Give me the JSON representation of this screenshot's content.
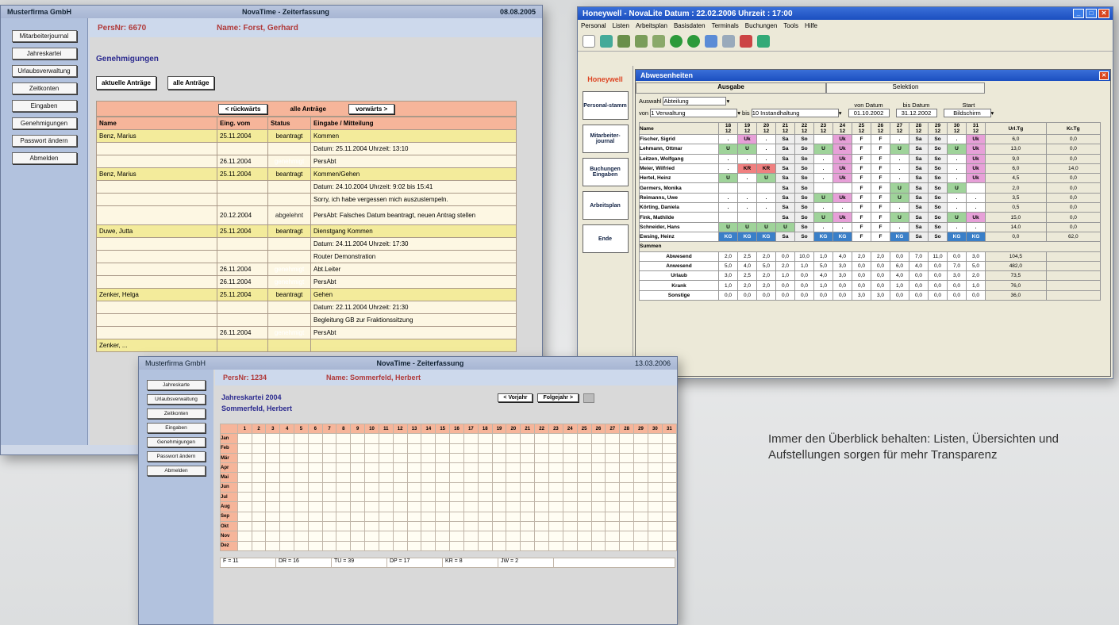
{
  "caption": "Immer den Überblick behalten: Listen, Übersichten und Aufstellungen sorgen für mehr Transparenz",
  "w1": {
    "company": "Musterfirma GmbH",
    "title": "NovaTime - Zeiterfassung",
    "date": "08.08.2005",
    "nav": [
      "Mitarbeiterjournal",
      "Jahreskartei",
      "Urlaubsverwaltung",
      "Zeitkonten",
      "Eingaben",
      "Genehmigungen",
      "Passwort ändern",
      "Abmelden"
    ],
    "persnr": "PersNr: 6670",
    "name": "Name: Forst, Gerhard",
    "section": "Genehmigungen",
    "btn_current": "aktuelle Anträge",
    "btn_all": "alle Anträge",
    "btn_back": "< rückwärts",
    "filter_label": "alle Anträge",
    "btn_fwd": "vorwärts >",
    "columns": [
      "Name",
      "Eing. vom",
      "Status",
      "Eingabe / Mitteilung"
    ],
    "rows": [
      [
        "Benz, Marius",
        "25.11.2004",
        "beantragt",
        "Kommen",
        "y"
      ],
      [
        "",
        "",
        "",
        "Datum: 25.11.2004 Uhrzeit: 13:10",
        ""
      ],
      [
        "",
        "26.11.2004",
        "genehmigt",
        "PersAbt",
        ""
      ],
      [
        "Benz, Marius",
        "25.11.2004",
        "beantragt",
        "Kommen/Gehen",
        "y"
      ],
      [
        "",
        "",
        "",
        "Datum: 24.10.2004 Uhrzeit: 9:02 bis 15:41",
        ""
      ],
      [
        "",
        "",
        "",
        "Sorry, ich habe vergessen mich auszustempeln.",
        ""
      ],
      [
        "",
        "20.12.2004",
        "abgelehnt",
        "PersAbt: Falsches Datum beantragt, neuen Antrag stellen",
        ""
      ],
      [
        "Duwe, Jutta",
        "25.11.2004",
        "beantragt",
        "Dienstgang Kommen",
        "y"
      ],
      [
        "",
        "",
        "",
        "Datum: 24.11.2004 Uhrzeit: 17:30",
        ""
      ],
      [
        "",
        "",
        "",
        "Router Demonstration",
        ""
      ],
      [
        "",
        "26.11.2004",
        "genehmigt",
        "Abt.Leiter",
        ""
      ],
      [
        "",
        "26.11.2004",
        "genehmigt",
        "PersAbt",
        ""
      ],
      [
        "Zenker, Helga",
        "25.11.2004",
        "beantragt",
        "Gehen",
        "y"
      ],
      [
        "",
        "",
        "",
        "Datum: 22.11.2004 Uhrzeit: 21:30",
        ""
      ],
      [
        "",
        "",
        "",
        "Begleitung GB zur Fraktionssitzung",
        ""
      ],
      [
        "",
        "26.11.2004",
        "genehmigt",
        "PersAbt",
        ""
      ],
      [
        "Zenker, ...",
        "",
        "",
        "",
        "y"
      ]
    ]
  },
  "w2": {
    "title": "Honeywell - NovaLite     Datum : 22.02.2006     Uhrzeit : 17:00",
    "menu": [
      "Personal",
      "Listen",
      "Arbeitsplan",
      "Basisdaten",
      "Terminals",
      "Buchungen",
      "Tools",
      "Hilfe"
    ],
    "logo": "Honeywell",
    "side": [
      "Personal-stamm",
      "Mitarbeiter-journal",
      "Buchungen Eingaben",
      "Arbeitsplan",
      "Ende"
    ],
    "panel": "Abwesenheiten",
    "tab1": "Ausgabe",
    "tab2": "Selektion",
    "auswahl_label": "Auswahl",
    "auswahl": "Abteilung",
    "von_label": "von",
    "von": "1 Verwaltung",
    "bis_label": "bis",
    "bis": "10 Instandhaltung",
    "vondatum_label": "von Datum",
    "vondatum": "01.10.2002",
    "bisdatum_label": "bis Datum",
    "bisdatum": "31.12.2002",
    "start_label": "Start",
    "start": "Bildschirm",
    "days": [
      "18",
      "19",
      "20",
      "21",
      "22",
      "23",
      "24",
      "25",
      "26",
      "27",
      "28",
      "29",
      "30",
      "31"
    ],
    "month": "12",
    "col_name": "Name",
    "col_url": "Url.Tg",
    "col_kr": "Kr.Tg",
    "rows": [
      [
        "Fischer, Sigrid",
        [
          ".",
          "Uk",
          ".",
          "Sa",
          "So",
          "",
          "Uk",
          "F",
          "F",
          ".",
          "Sa",
          "So",
          ".",
          "Uk"
        ],
        "6,0",
        "0,0"
      ],
      [
        "Lehmann, Ottmar",
        [
          "U",
          "U",
          ".",
          "Sa",
          "So",
          "U",
          "Uk",
          "F",
          "F",
          "U",
          "Sa",
          "So",
          "U",
          "Uk"
        ],
        "13,0",
        "0,0"
      ],
      [
        "Leitzen, Wolfgang",
        [
          ".",
          ".",
          ".",
          "Sa",
          "So",
          ".",
          "Uk",
          "F",
          "F",
          ".",
          "Sa",
          "So",
          ".",
          "Uk"
        ],
        "9,0",
        "0,0"
      ],
      [
        "Meier, Wilfried",
        [
          ".",
          "KR",
          "KR",
          "Sa",
          "So",
          ".",
          "Uk",
          "F",
          "F",
          ".",
          "Sa",
          "So",
          ".",
          "Uk"
        ],
        "6,0",
        "14,0"
      ],
      [
        "Hertel, Heinz",
        [
          "U",
          ".",
          "U",
          "Sa",
          "So",
          ".",
          "Uk",
          "F",
          "F",
          ".",
          "Sa",
          "So",
          ".",
          "Uk"
        ],
        "4,5",
        "0,0"
      ],
      [
        "Germers, Monika",
        [
          "",
          "",
          "",
          "Sa",
          "So",
          "",
          "",
          "F",
          "F",
          "U",
          "Sa",
          "So",
          "U",
          ""
        ],
        "2,0",
        "0,0"
      ],
      [
        "Reimanns, Uwe",
        [
          ".",
          ".",
          ".",
          "Sa",
          "So",
          "U",
          "Uk",
          "F",
          "F",
          "U",
          "Sa",
          "So",
          ".",
          "."
        ],
        "3,5",
        "0,0"
      ],
      [
        "Körting, Daniela",
        [
          ".",
          ".",
          ".",
          "Sa",
          "So",
          ".",
          ".",
          "F",
          "F",
          ".",
          "Sa",
          "So",
          ".",
          "."
        ],
        "0,5",
        "0,0"
      ],
      [
        "Fink, Mathilde",
        [
          "",
          "",
          "",
          "Sa",
          "So",
          "U",
          "Uk",
          "F",
          "F",
          "U",
          "Sa",
          "So",
          "U",
          "Uk"
        ],
        "15,0",
        "0,0"
      ],
      [
        "Schneider, Hans",
        [
          "U",
          "U",
          "U",
          "U",
          "So",
          ".",
          ".",
          "F",
          "F",
          ".",
          "Sa",
          "So",
          ".",
          "."
        ],
        "14,0",
        "0,0"
      ],
      [
        "Ewsing, Heinz",
        [
          "KG",
          "KG",
          "KG",
          "Sa",
          "So",
          "KG",
          "KG",
          "F",
          "F",
          "KG",
          "Sa",
          "So",
          "KG",
          "KG"
        ],
        "0,0",
        "62,0"
      ]
    ],
    "sums_label": "Summen",
    "sums": [
      [
        "Abwesend",
        [
          "2,0",
          "2,5",
          "2,0",
          "0,0",
          "10,0",
          "1,0",
          "4,0",
          "2,0",
          "2,0",
          "0,0",
          "7,0",
          "11,0",
          "0,0",
          "3,0"
        ],
        "104,5"
      ],
      [
        "Anwesend",
        [
          "5,0",
          "4,0",
          "5,0",
          "2,0",
          "1,0",
          "5,0",
          "3,0",
          "0,0",
          "0,0",
          "6,0",
          "4,0",
          "0,0",
          "7,0",
          "5,0"
        ],
        "482,0"
      ],
      [
        "Urlaub",
        [
          "3,0",
          "2,5",
          "2,0",
          "1,0",
          "0,0",
          "4,0",
          "3,0",
          "0,0",
          "0,0",
          "4,0",
          "0,0",
          "0,0",
          "3,0",
          "2,0"
        ],
        "73,5"
      ],
      [
        "Krank",
        [
          "1,0",
          "2,0",
          "2,0",
          "0,0",
          "0,0",
          "1,0",
          "0,0",
          "0,0",
          "0,0",
          "1,0",
          "0,0",
          "0,0",
          "0,0",
          "1,0"
        ],
        "76,0"
      ],
      [
        "Sonstige",
        [
          "0,0",
          "0,0",
          "0,0",
          "0,0",
          "0,0",
          "0,0",
          "0,0",
          "3,0",
          "3,0",
          "0,0",
          "0,0",
          "0,0",
          "0,0",
          "0,0"
        ],
        "36,0"
      ]
    ]
  },
  "w3": {
    "company": "Musterfirma GmbH",
    "title": "NovaTime - Zeiterfassung",
    "date": "13.03.2006",
    "nav": [
      "Jahreskarte",
      "Urlaubsverwaltung",
      "Zeitkonten",
      "Eingaben",
      "Genehmigungen",
      "Passwort ändern",
      "Abmelden"
    ],
    "persnr": "PersNr: 1234",
    "name": "Name: Sommerfeld, Herbert",
    "card_title": "Jahreskartei 2004",
    "card_name": "Sommerfeld, Herbert",
    "btn_prev": "< Vorjahr",
    "btn_next": "Folgejahr >",
    "months": [
      "Jan",
      "Feb",
      "Mär",
      "Apr",
      "Mai",
      "Jun",
      "Jul",
      "Aug",
      "Sep",
      "Okt",
      "Nov",
      "Dez"
    ],
    "summary": [
      "F = 11",
      "DR = 16",
      "TU = 39",
      "DP = 17",
      "KR = 8",
      "JW = 2"
    ]
  }
}
